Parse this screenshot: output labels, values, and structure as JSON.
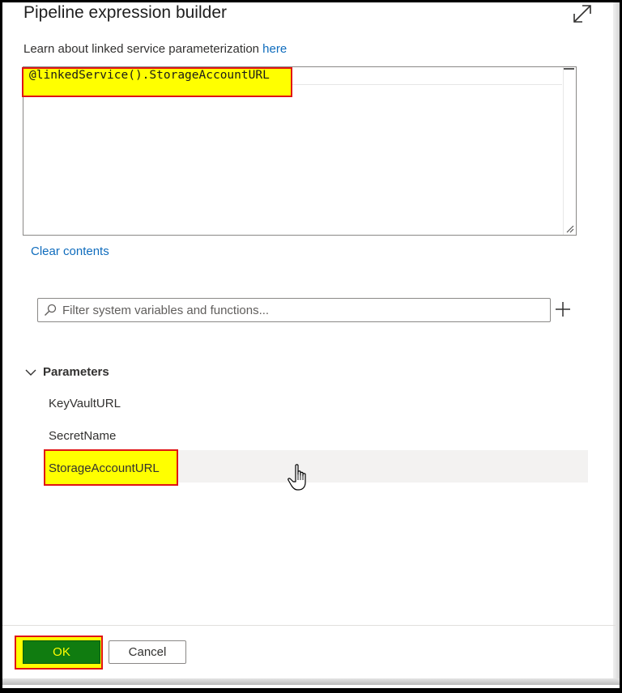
{
  "dialog": {
    "title": "Pipeline expression builder"
  },
  "learn": {
    "text": "Learn about linked service parameterization ",
    "link": "here"
  },
  "editor": {
    "value": "@linkedService().StorageAccountURL"
  },
  "clear_contents": "Clear contents",
  "filter": {
    "placeholder": "Filter system variables and functions..."
  },
  "parameters": {
    "label": "Parameters",
    "items": [
      "KeyVaultURL",
      "SecretName",
      "StorageAccountURL"
    ]
  },
  "footer": {
    "ok_label": "OK",
    "cancel_label": "Cancel"
  },
  "colors": {
    "highlight": "#ffff00",
    "highlight_border": "#e01414",
    "ok_button": "#107c10",
    "link": "#0f6cbd"
  },
  "icons": [
    "expand-icon",
    "search-icon",
    "add-icon",
    "chevron-down-icon",
    "hand-cursor-icon"
  ]
}
